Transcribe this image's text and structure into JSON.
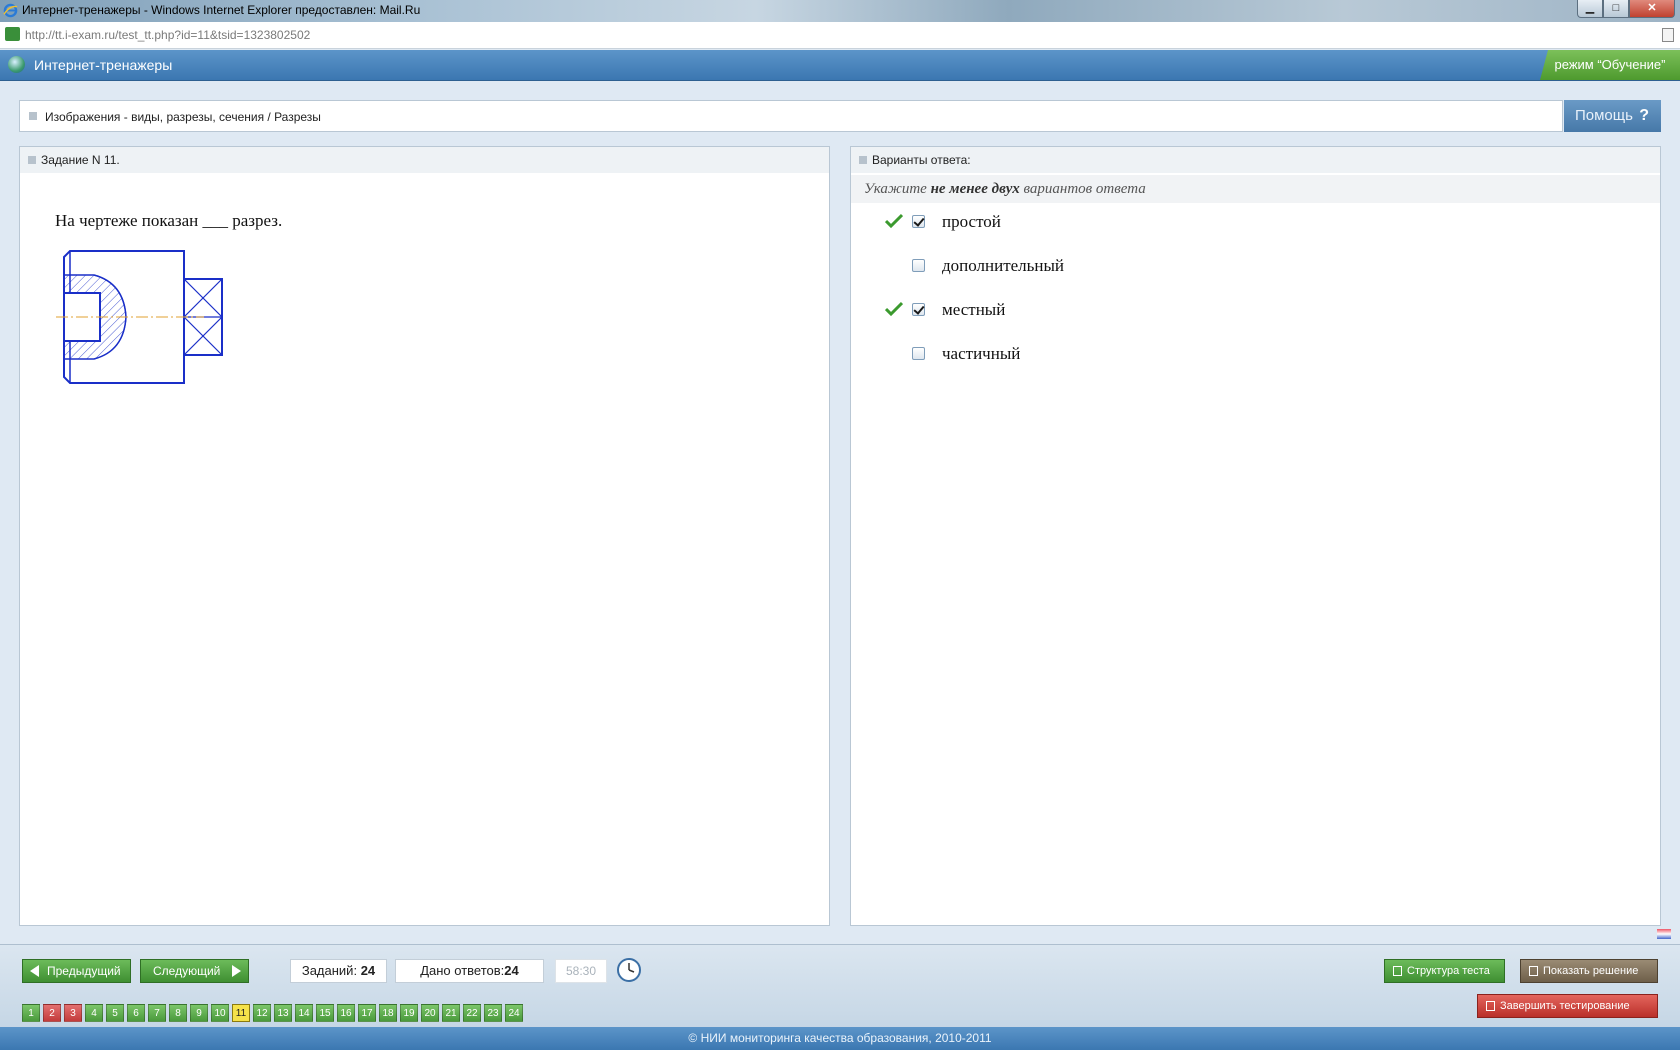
{
  "window": {
    "title": "Интернет-тренажеры - Windows Internet Explorer предоставлен: Mail.Ru",
    "url": "http://tt.i-exam.ru/test_tt.php?id=11&tsid=1323802502",
    "minimize_label": "▁",
    "maximize_label": "□",
    "close_label": "✕"
  },
  "header": {
    "app_title": "Интернет-тренажеры",
    "mode": "режим “Обучение”"
  },
  "breadcrumb": {
    "path": "Изображения - виды, разрезы, сечения / Разрезы",
    "help_label": "Помощь",
    "help_icon": "?"
  },
  "task": {
    "heading": "Задание N 11.",
    "question": "На чертеже показан ___ разрез."
  },
  "answers": {
    "heading": "Варианты ответа:",
    "instruction_prefix": "Укажите ",
    "instruction_bold": "не менее двух",
    "instruction_suffix": " вариантов ответа",
    "options": [
      {
        "label": "простой",
        "checked": true,
        "correct_mark": true
      },
      {
        "label": "дополнительный",
        "checked": false,
        "correct_mark": false
      },
      {
        "label": "местный",
        "checked": true,
        "correct_mark": true
      },
      {
        "label": "частичный",
        "checked": false,
        "correct_mark": false
      }
    ]
  },
  "toolbar": {
    "prev_label": "Предыдущий",
    "next_label": "Следующий",
    "total_label": "Заданий:",
    "total_value": "24",
    "answered_label": "Дано ответов:",
    "answered_value": "24",
    "timer": "58:30",
    "structure_label": "Структура теста",
    "solution_label": "Показать решение",
    "finish_label": "Завершить тестирование"
  },
  "pager": {
    "pages": [
      {
        "n": "1",
        "status": "green"
      },
      {
        "n": "2",
        "status": "red"
      },
      {
        "n": "3",
        "status": "red"
      },
      {
        "n": "4",
        "status": "green"
      },
      {
        "n": "5",
        "status": "green"
      },
      {
        "n": "6",
        "status": "green"
      },
      {
        "n": "7",
        "status": "green"
      },
      {
        "n": "8",
        "status": "green"
      },
      {
        "n": "9",
        "status": "green"
      },
      {
        "n": "10",
        "status": "green"
      },
      {
        "n": "11",
        "status": "current"
      },
      {
        "n": "12",
        "status": "green"
      },
      {
        "n": "13",
        "status": "green"
      },
      {
        "n": "14",
        "status": "green"
      },
      {
        "n": "15",
        "status": "green"
      },
      {
        "n": "16",
        "status": "green"
      },
      {
        "n": "17",
        "status": "green"
      },
      {
        "n": "18",
        "status": "green"
      },
      {
        "n": "19",
        "status": "green"
      },
      {
        "n": "20",
        "status": "green"
      },
      {
        "n": "21",
        "status": "green"
      },
      {
        "n": "22",
        "status": "green"
      },
      {
        "n": "23",
        "status": "green"
      },
      {
        "n": "24",
        "status": "green"
      }
    ]
  },
  "footer": {
    "copyright": "© НИИ мониторинга качества образования, 2010-2011"
  },
  "colors": {
    "header_blue": "#3b77b1",
    "accent_green": "#4a9a3c",
    "error_red": "#c33b3b",
    "current_yellow": "#f5e24a",
    "drawing_blue": "#1a2fc8",
    "axis_orange": "#e0a030"
  }
}
